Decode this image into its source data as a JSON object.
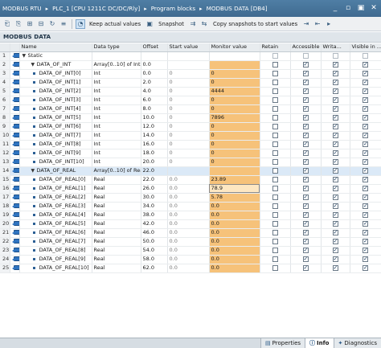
{
  "breadcrumb": [
    "MODBUS RTU",
    "PLC_1 [CPU 1211C DC/DC/Rly]",
    "Program blocks",
    "MODBUS DATA [DB4]"
  ],
  "breadcrumb_separator": "▸",
  "window_buttons": {
    "minimize": "_",
    "restore": "▫",
    "tile": "▣",
    "close": "✕"
  },
  "toolbar": {
    "keep_actual_values": "Keep actual values",
    "snapshot": "Snapshot",
    "copy_snapshots": "Copy snapshots to start values",
    "more": "▸"
  },
  "block_title": "MODBUS DATA",
  "columns": {
    "num": "",
    "icon": "",
    "name": "Name",
    "data_type": "Data type",
    "offset": "Offset",
    "start_value": "Start value",
    "monitor_value": "Monitor value",
    "retain": "Retain",
    "accessible": "Accessible f...",
    "writable": "Writa...",
    "visible": "Visible in ..."
  },
  "rows": [
    {
      "n": "1",
      "name": "Static",
      "level": 0,
      "expander": "▼",
      "type": "",
      "offset": "",
      "start": "",
      "monitor": "",
      "mon_style": "none",
      "retain": false,
      "acc": false,
      "wr": false,
      "vis": false,
      "checks": false
    },
    {
      "n": "2",
      "name": "DATA_OF_INT",
      "level": 1,
      "expander": "▼",
      "type": "Array[0..10] of Int",
      "offset": "0.0",
      "start": "",
      "monitor": "",
      "mon_style": "none",
      "retain": false,
      "acc": true,
      "wr": true,
      "vis": true,
      "checks": true
    },
    {
      "n": "3",
      "name": "DATA_OF_INT[0]",
      "level": 2,
      "type": "Int",
      "offset": "0.0",
      "start": "0",
      "monitor": "0",
      "mon_style": "val",
      "retain": false,
      "acc": true,
      "wr": true,
      "vis": true,
      "checks": true
    },
    {
      "n": "4",
      "name": "DATA_OF_INT[1]",
      "level": 2,
      "type": "Int",
      "offset": "2.0",
      "start": "0",
      "monitor": "0",
      "mon_style": "val",
      "retain": false,
      "acc": true,
      "wr": true,
      "vis": true,
      "checks": true
    },
    {
      "n": "5",
      "name": "DATA_OF_INT[2]",
      "level": 2,
      "type": "Int",
      "offset": "4.0",
      "start": "0",
      "monitor": "4444",
      "mon_style": "val",
      "retain": false,
      "acc": true,
      "wr": true,
      "vis": true,
      "checks": true
    },
    {
      "n": "6",
      "name": "DATA_OF_INT[3]",
      "level": 2,
      "type": "Int",
      "offset": "6.0",
      "start": "0",
      "monitor": "0",
      "mon_style": "val",
      "retain": false,
      "acc": true,
      "wr": true,
      "vis": true,
      "checks": true
    },
    {
      "n": "7",
      "name": "DATA_OF_INT[4]",
      "level": 2,
      "type": "Int",
      "offset": "8.0",
      "start": "0",
      "monitor": "0",
      "mon_style": "val",
      "retain": false,
      "acc": true,
      "wr": true,
      "vis": true,
      "checks": true
    },
    {
      "n": "8",
      "name": "DATA_OF_INT[5]",
      "level": 2,
      "type": "Int",
      "offset": "10.0",
      "start": "0",
      "monitor": "7896",
      "mon_style": "val",
      "retain": false,
      "acc": true,
      "wr": true,
      "vis": true,
      "checks": true
    },
    {
      "n": "9",
      "name": "DATA_OF_INT[6]",
      "level": 2,
      "type": "Int",
      "offset": "12.0",
      "start": "0",
      "monitor": "0",
      "mon_style": "val",
      "retain": false,
      "acc": true,
      "wr": true,
      "vis": true,
      "checks": true
    },
    {
      "n": "10",
      "name": "DATA_OF_INT[7]",
      "level": 2,
      "type": "Int",
      "offset": "14.0",
      "start": "0",
      "monitor": "0",
      "mon_style": "val",
      "retain": false,
      "acc": true,
      "wr": true,
      "vis": true,
      "checks": true
    },
    {
      "n": "11",
      "name": "DATA_OF_INT[8]",
      "level": 2,
      "type": "Int",
      "offset": "16.0",
      "start": "0",
      "monitor": "0",
      "mon_style": "val",
      "retain": false,
      "acc": true,
      "wr": true,
      "vis": true,
      "checks": true
    },
    {
      "n": "12",
      "name": "DATA_OF_INT[9]",
      "level": 2,
      "type": "Int",
      "offset": "18.0",
      "start": "0",
      "monitor": "0",
      "mon_style": "val",
      "retain": false,
      "acc": true,
      "wr": true,
      "vis": true,
      "checks": true
    },
    {
      "n": "13",
      "name": "DATA_OF_INT[10]",
      "level": 2,
      "type": "Int",
      "offset": "20.0",
      "start": "0",
      "monitor": "0",
      "mon_style": "val",
      "retain": false,
      "acc": true,
      "wr": true,
      "vis": true,
      "checks": true
    },
    {
      "n": "14",
      "name": "DATA_OF_REAL",
      "level": 1,
      "expander": "▼",
      "type": "Array[0..10] of Real",
      "offset": "22.0",
      "start": "",
      "monitor": "",
      "mon_style": "none",
      "retain": false,
      "acc": true,
      "wr": true,
      "vis": true,
      "checks": true,
      "selected": true
    },
    {
      "n": "15",
      "name": "DATA_OF_REAL[0]",
      "level": 2,
      "type": "Real",
      "offset": "22.0",
      "start": "0.0",
      "monitor": "23.89",
      "mon_style": "val",
      "retain": false,
      "acc": true,
      "wr": true,
      "vis": true,
      "checks": true
    },
    {
      "n": "16",
      "name": "DATA_OF_REAL[1]",
      "level": 2,
      "type": "Real",
      "offset": "26.0",
      "start": "0.0",
      "monitor": "78.9",
      "mon_style": "sel",
      "retain": false,
      "acc": true,
      "wr": true,
      "vis": true,
      "checks": true
    },
    {
      "n": "17",
      "name": "DATA_OF_REAL[2]",
      "level": 2,
      "type": "Real",
      "offset": "30.0",
      "start": "0.0",
      "monitor": "5.78",
      "mon_style": "val",
      "retain": false,
      "acc": true,
      "wr": true,
      "vis": true,
      "checks": true
    },
    {
      "n": "18",
      "name": "DATA_OF_REAL[3]",
      "level": 2,
      "type": "Real",
      "offset": "34.0",
      "start": "0.0",
      "monitor": "0.0",
      "mon_style": "val",
      "retain": false,
      "acc": true,
      "wr": true,
      "vis": true,
      "checks": true
    },
    {
      "n": "19",
      "name": "DATA_OF_REAL[4]",
      "level": 2,
      "type": "Real",
      "offset": "38.0",
      "start": "0.0",
      "monitor": "0.0",
      "mon_style": "val",
      "retain": false,
      "acc": true,
      "wr": true,
      "vis": true,
      "checks": true
    },
    {
      "n": "20",
      "name": "DATA_OF_REAL[5]",
      "level": 2,
      "type": "Real",
      "offset": "42.0",
      "start": "0.0",
      "monitor": "0.0",
      "mon_style": "val",
      "retain": false,
      "acc": true,
      "wr": true,
      "vis": true,
      "checks": true
    },
    {
      "n": "21",
      "name": "DATA_OF_REAL[6]",
      "level": 2,
      "type": "Real",
      "offset": "46.0",
      "start": "0.0",
      "monitor": "0.0",
      "mon_style": "val",
      "retain": false,
      "acc": true,
      "wr": true,
      "vis": true,
      "checks": true
    },
    {
      "n": "22",
      "name": "DATA_OF_REAL[7]",
      "level": 2,
      "type": "Real",
      "offset": "50.0",
      "start": "0.0",
      "monitor": "0.0",
      "mon_style": "val",
      "retain": false,
      "acc": true,
      "wr": true,
      "vis": true,
      "checks": true
    },
    {
      "n": "23",
      "name": "DATA_OF_REAL[8]",
      "level": 2,
      "type": "Real",
      "offset": "54.0",
      "start": "0.0",
      "monitor": "0.0",
      "mon_style": "val",
      "retain": false,
      "acc": true,
      "wr": true,
      "vis": true,
      "checks": true
    },
    {
      "n": "24",
      "name": "DATA_OF_REAL[9]",
      "level": 2,
      "type": "Real",
      "offset": "58.0",
      "start": "0.0",
      "monitor": "0.0",
      "mon_style": "val",
      "retain": false,
      "acc": true,
      "wr": true,
      "vis": true,
      "checks": true
    },
    {
      "n": "25",
      "name": "DATA_OF_REAL[10]",
      "level": 2,
      "type": "Real",
      "offset": "62.0",
      "start": "0.0",
      "monitor": "0.0",
      "mon_style": "val",
      "retain": false,
      "acc": true,
      "wr": true,
      "vis": true,
      "checks": true
    }
  ],
  "status_tabs": [
    {
      "label": "Properties",
      "icon": "properties-icon",
      "glyph": "▤"
    },
    {
      "label": "Info",
      "icon": "info-icon",
      "glyph": "ⓘ",
      "active": true
    },
    {
      "label": "Diagnostics",
      "icon": "diagnostics-icon",
      "glyph": "✦"
    }
  ],
  "colors": {
    "title_bar": "#4a7aa3",
    "monitor_cell": "#f6c27a",
    "row_icon": "#2f74c0",
    "selected_row": "#dbe9f7"
  }
}
